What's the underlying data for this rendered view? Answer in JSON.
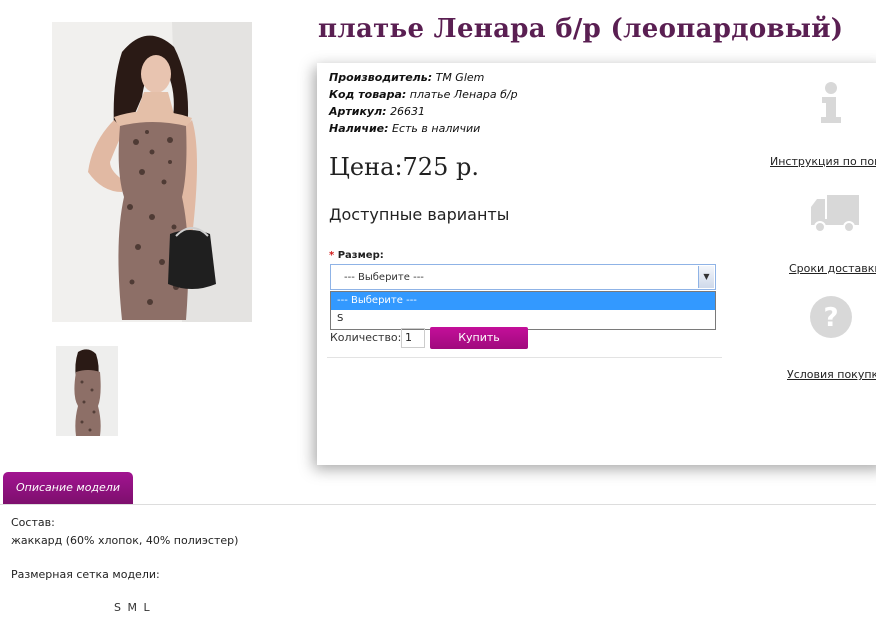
{
  "product": {
    "title": "платье Ленара б/р (леопардовый)",
    "meta": {
      "manufacturer_label": "Производитель:",
      "manufacturer_value": "TM Glem",
      "code_label": "Код товара:",
      "code_value": "платье Ленара б/р",
      "sku_label": "Артикул:",
      "sku_value": "26631",
      "stock_label": "Наличие:",
      "stock_value": "Есть в наличии"
    },
    "price": "Цена:725 р.",
    "variants_heading": "Доступные варианты",
    "size": {
      "label": "Размер:",
      "required_mark": "*",
      "selected": "--- Выберите ---",
      "options": [
        "--- Выберите ---",
        "S"
      ]
    },
    "quantity": {
      "label": "Количество:",
      "value": "1"
    },
    "buy_label": "Купить"
  },
  "side_links": {
    "instruction": "Инструкция по покупке",
    "delivery": "Сроки доставки",
    "terms": "Условия покупки"
  },
  "tabs": {
    "description": "Описание модели"
  },
  "description": {
    "composition_label": "Состав:",
    "composition_value": "жаккард (60% хлопок, 40% полиэстер)",
    "size_chart_label": "Размерная сетка модели:",
    "sizes": "S M L"
  },
  "colors": {
    "accent": "#a21491",
    "title": "#5a1f52",
    "select_highlight": "#3399ff"
  },
  "icons": [
    "info-icon",
    "truck-icon",
    "question-icon",
    "chevron-down-icon"
  ]
}
